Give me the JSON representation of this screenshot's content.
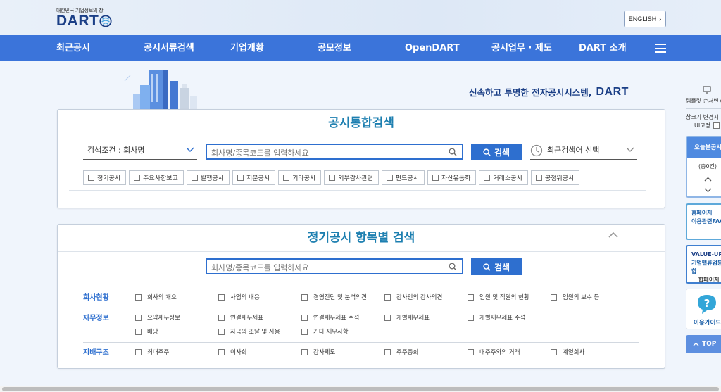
{
  "header": {
    "logo_tagline": "대한민국 기업정보의 창",
    "logo_text": "DART",
    "english_label": "ENGLISH"
  },
  "nav": {
    "items": [
      "최근공시",
      "공시서류검색",
      "기업개황",
      "공모정보",
      "OpenDART",
      "공시업무 · 제도",
      "DART 소개"
    ]
  },
  "hero": {
    "slogan": "신속하고 투명한 전자공시시스템,",
    "slogan_brand": "DART"
  },
  "integrated_search": {
    "title": "공시통합검색",
    "condition_label": "검색조건 : 회사명",
    "input_placeholder": "회사명/종목코드를 입력하세요",
    "search_button": "검색",
    "recent_label": "최근검색어 선택",
    "filters": [
      "정기공시",
      "주요사항보고",
      "발행공시",
      "지분공시",
      "기타공시",
      "외부감사관련",
      "펀드공시",
      "자산유동화",
      "거래소공시",
      "공정위공시"
    ]
  },
  "item_search": {
    "title": "정기공시 항목별 검색",
    "input_placeholder": "회사명/종목코드를 입력하세요",
    "search_button": "검색",
    "categories": [
      {
        "label": "회사현황",
        "options": [
          "회사의 개요",
          "사업의 내용",
          "경영진단 및 분석의견",
          "감사인의 감사의견",
          "임원 및 직원의 현황",
          "임원의 보수 등"
        ]
      },
      {
        "label": "재무정보",
        "options": [
          "요약재무정보",
          "연결재무제표",
          "연결재무제표 주석",
          "개별재무제표",
          "개별재무제표 주석",
          "배당",
          "자금의 조달 및 사용",
          "기타 재무사항"
        ]
      },
      {
        "label": "지배구조",
        "options": [
          "최대주주",
          "이사회",
          "감사제도",
          "주주총회",
          "대주주와의 거래",
          "계열회사"
        ]
      }
    ]
  },
  "sidebar": {
    "template_label": "템플릿 순서변경",
    "window_label": "창크기 변경시",
    "ui_fix_label": "UI고정",
    "today_label": "오늘본공시",
    "today_count": "(총0건)",
    "homepage_line1": "홈페이지",
    "homepage_line2": "이용관련FAQ",
    "value_up_line1": "VALUE-UP",
    "value_up_line2": "기업밸류업통합",
    "value_up_line3": "합페이지",
    "guide_label": "이용가이드",
    "top_label": "TOP"
  }
}
